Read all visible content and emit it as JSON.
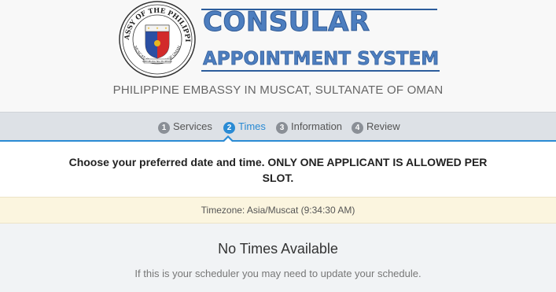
{
  "header": {
    "seal_text_top": "EMBASSY OF THE PHILIPPINES",
    "seal_text_bottom": "MUSCAT, SULTANATE OF OMAN",
    "seal_banner": "REPUBLIKA NG PILIPINAS",
    "title_line1": "CONSULAR",
    "title_line2": "APPOINTMENT SYSTEM",
    "subtitle": "PHILIPPINE EMBASSY IN MUSCAT, SULTANATE OF OMAN"
  },
  "steps": [
    {
      "num": "1",
      "label": "Services",
      "active": false
    },
    {
      "num": "2",
      "label": "Times",
      "active": true
    },
    {
      "num": "3",
      "label": "Information",
      "active": false
    },
    {
      "num": "4",
      "label": "Review",
      "active": false
    }
  ],
  "instructions": "Choose your preferred date and time. ONLY ONE APPLICANT IS ALLOWED PER SLOT.",
  "timezone": "Timezone: Asia/Muscat (9:34:30 AM)",
  "empty_state": {
    "title": "No Times Available",
    "hint": "If this is your scheduler you may need to update your schedule."
  },
  "colors": {
    "accent": "#2a8bd4",
    "title_blue": "#4d7ebf",
    "timezone_bg": "#fbf5df"
  }
}
